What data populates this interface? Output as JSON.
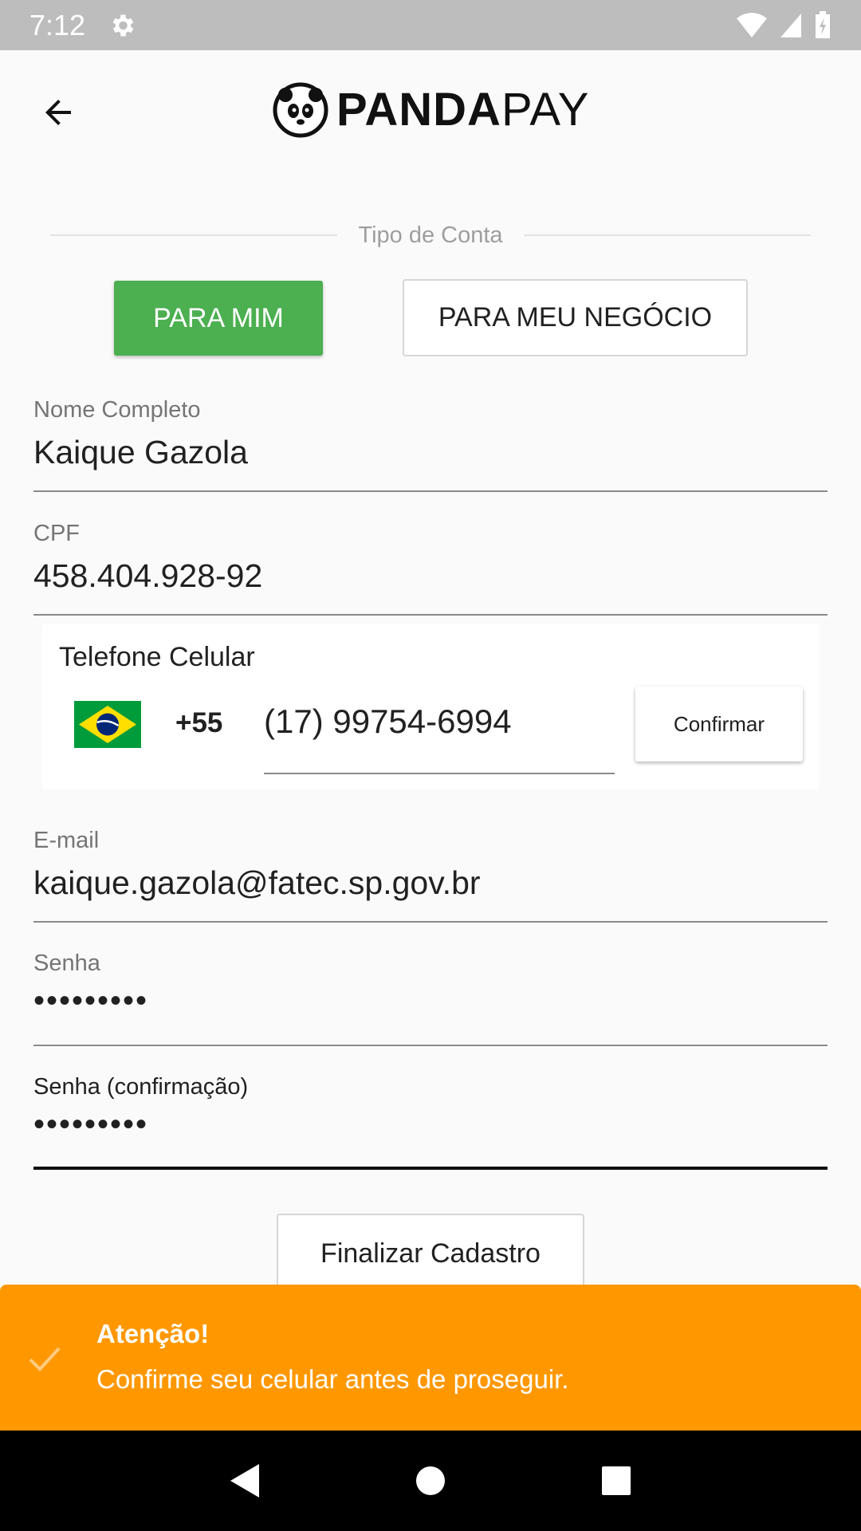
{
  "status_bar": {
    "time": "7:12"
  },
  "app_bar": {
    "logo_bold": "PANDA",
    "logo_light": "PAY"
  },
  "account_type": {
    "title": "Tipo de Conta",
    "option_personal": "PARA MIM",
    "option_business": "PARA MEU NEGÓCIO",
    "selected": "PARA MIM",
    "selected_color": "#4caf50"
  },
  "form": {
    "name": {
      "label": "Nome Completo",
      "value": "Kaique Gazola"
    },
    "cpf": {
      "label": "CPF",
      "value": "458.404.928-92"
    },
    "phone": {
      "label": "Telefone Celular",
      "country_flag": "brazil-flag",
      "ddi": "+55",
      "value": "(17) 99754-6994",
      "confirm_label": "Confirmar"
    },
    "email": {
      "label": "E-mail",
      "value": "kaique.gazola@fatec.sp.gov.br"
    },
    "password": {
      "label": "Senha",
      "value": "•••••••••"
    },
    "password_confirm": {
      "label": "Senha (confirmação)",
      "value": "•••••••••"
    },
    "submit_label": "Finalizar Cadastro"
  },
  "alert": {
    "title": "Atenção!",
    "message": "Confirme seu celular antes de proseguir.",
    "icon": "check-icon",
    "color": "#ff9800"
  },
  "nav_bar": {
    "icons": [
      "back-triangle-icon",
      "home-circle-icon",
      "recents-square-icon"
    ]
  }
}
